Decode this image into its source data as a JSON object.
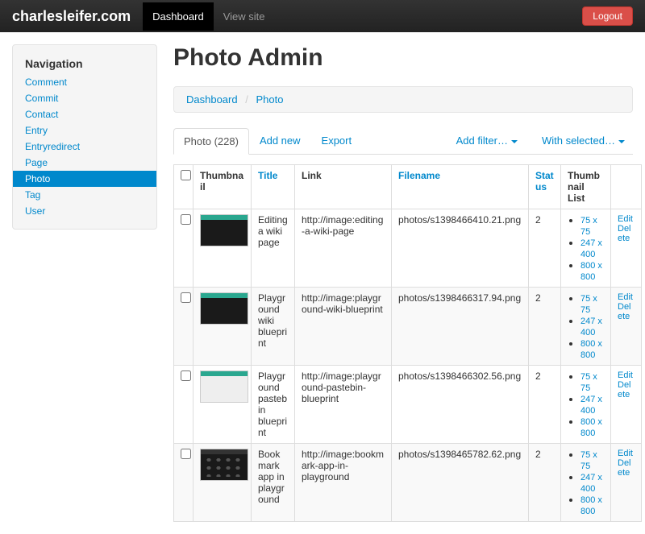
{
  "navbar": {
    "brand": "charlesleifer.com",
    "dashboard": "Dashboard",
    "view_site": "View site",
    "logout": "Logout"
  },
  "sidebar": {
    "header": "Navigation",
    "items": [
      {
        "label": "Comment"
      },
      {
        "label": "Commit"
      },
      {
        "label": "Contact"
      },
      {
        "label": "Entry"
      },
      {
        "label": "Entryredirect"
      },
      {
        "label": "Page"
      },
      {
        "label": "Photo",
        "active": true
      },
      {
        "label": "Tag"
      },
      {
        "label": "User"
      }
    ]
  },
  "page": {
    "title": "Photo Admin"
  },
  "breadcrumb": {
    "dashboard": "Dashboard",
    "sep": "/",
    "current": "Photo"
  },
  "tabs": {
    "main": "Photo (228)",
    "add": "Add new",
    "export": "Export",
    "filter": "Add filter…",
    "selected": "With selected…"
  },
  "table": {
    "headers": {
      "thumbnail": "Thumbnail",
      "title": "Title",
      "link": "Link",
      "filename": "Filename",
      "status": "Status",
      "thumblist": "Thumbnail List"
    },
    "sizes": [
      "75 x 75",
      "247 x 400",
      "800 x 800"
    ],
    "actions": {
      "edit": "Edit",
      "delete": "Delete"
    },
    "rows": [
      {
        "title": "Editing a wiki page",
        "link": "http://image:editing-a-wiki-page",
        "filename": "photos/s1398466410.21.png",
        "status": "2",
        "thumb": "dark"
      },
      {
        "title": "Playground wiki blueprint",
        "link": "http://image:playground-wiki-blueprint",
        "filename": "photos/s1398466317.94.png",
        "status": "2",
        "thumb": "dark"
      },
      {
        "title": "Playground pastebin blueprint",
        "link": "http://image:playground-pastebin-blueprint",
        "filename": "photos/s1398466302.56.png",
        "status": "2",
        "thumb": "light"
      },
      {
        "title": "Bookmark app in playground",
        "link": "http://image:bookmark-app-in-playground",
        "filename": "photos/s1398465782.62.png",
        "status": "2",
        "thumb": "grid"
      }
    ]
  }
}
